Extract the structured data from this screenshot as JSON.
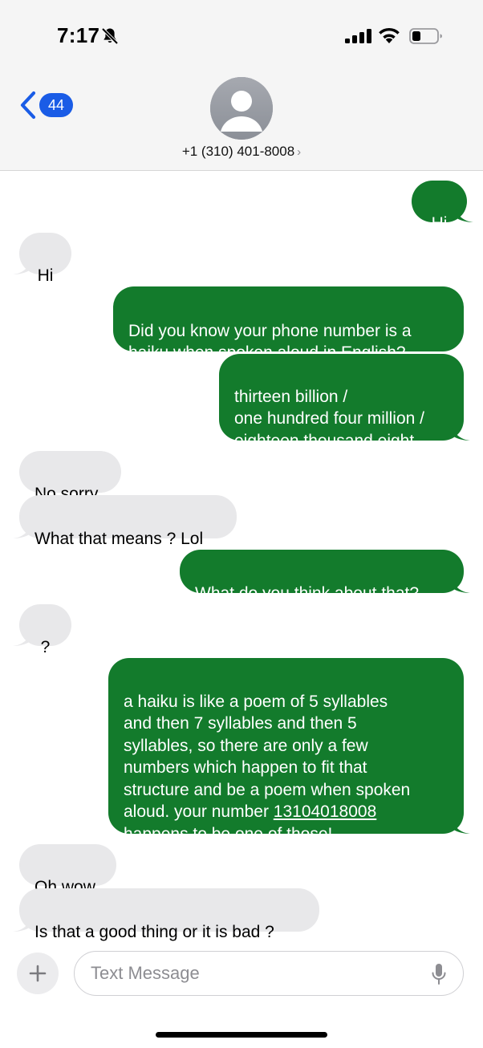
{
  "status_bar": {
    "time": "7:17",
    "icons": [
      "bell-slash-icon",
      "cellular-signal-icon",
      "wifi-icon",
      "battery-icon"
    ],
    "battery_level": 0.3
  },
  "header": {
    "back_badge_count": "44",
    "contact_name": "+1 (310) 401-8008",
    "chevron": "›",
    "accent_color": "#1a5ce6"
  },
  "messages": [
    {
      "from": "me",
      "text": "Hi"
    },
    {
      "from": "them",
      "text": "Hi"
    },
    {
      "from": "me",
      "text": "Did you know your phone number is a\nhaiku when spoken aloud in English?"
    },
    {
      "from": "me",
      "text": "thirteen billion /\none hundred four million /\neighteen thousand eight"
    },
    {
      "from": "them",
      "text": "No sorry"
    },
    {
      "from": "them",
      "text": "What that means ? Lol"
    },
    {
      "from": "me",
      "text": "What do you think about that?"
    },
    {
      "from": "them",
      "text": "?"
    },
    {
      "from": "me",
      "text_before": "a haiku is like a poem of 5 syllables\nand then 7 syllables and then 5\nsyllables, so there are only a few\nnumbers which happen to fit that\nstructure and be a poem when spoken\naloud. your number ",
      "link": "13104018008",
      "text_after": "\nhappens to be one of those!"
    },
    {
      "from": "them",
      "text": "Oh wow"
    },
    {
      "from": "them",
      "text": "Is that a good thing or it is bad ?"
    }
  ],
  "colors": {
    "sent_bubble": "#137b2c",
    "received_bubble": "#e8e8ea"
  },
  "composer": {
    "placeholder": "Text Message",
    "plus_label": "+"
  }
}
